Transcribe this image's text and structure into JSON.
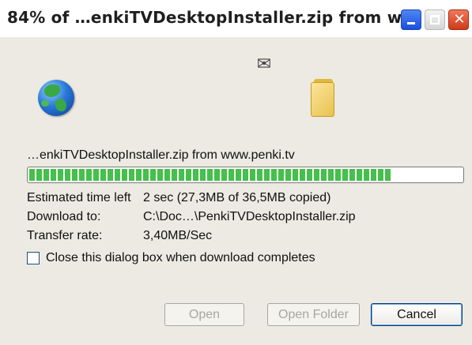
{
  "window": {
    "title": "84% of …enkiTVDesktopInstaller.zip from w…"
  },
  "icons": {
    "globe": "globe-icon",
    "paper": "flying-paper-icon",
    "folder": "folder-icon"
  },
  "download": {
    "source": "…enkiTVDesktopInstaller.zip from www.penki.tv",
    "progress_percent": 84,
    "estimated_label": "Estimated time left",
    "estimated_value": "2 sec (27,3MB of 36,5MB copied)",
    "download_to_label": "Download to:",
    "download_to_value": "C:\\Doc…\\PenkiTVDesktopInstaller.zip",
    "transfer_label": "Transfer rate:",
    "transfer_value": "3,40MB/Sec"
  },
  "options": {
    "close_when_done_label": "Close this dialog box when download completes",
    "close_when_done_checked": false
  },
  "buttons": {
    "open": "Open",
    "open_folder": "Open Folder",
    "cancel": "Cancel"
  },
  "colors": {
    "progress_fill": "#44c04b",
    "dialog_bg": "#eceae2"
  }
}
